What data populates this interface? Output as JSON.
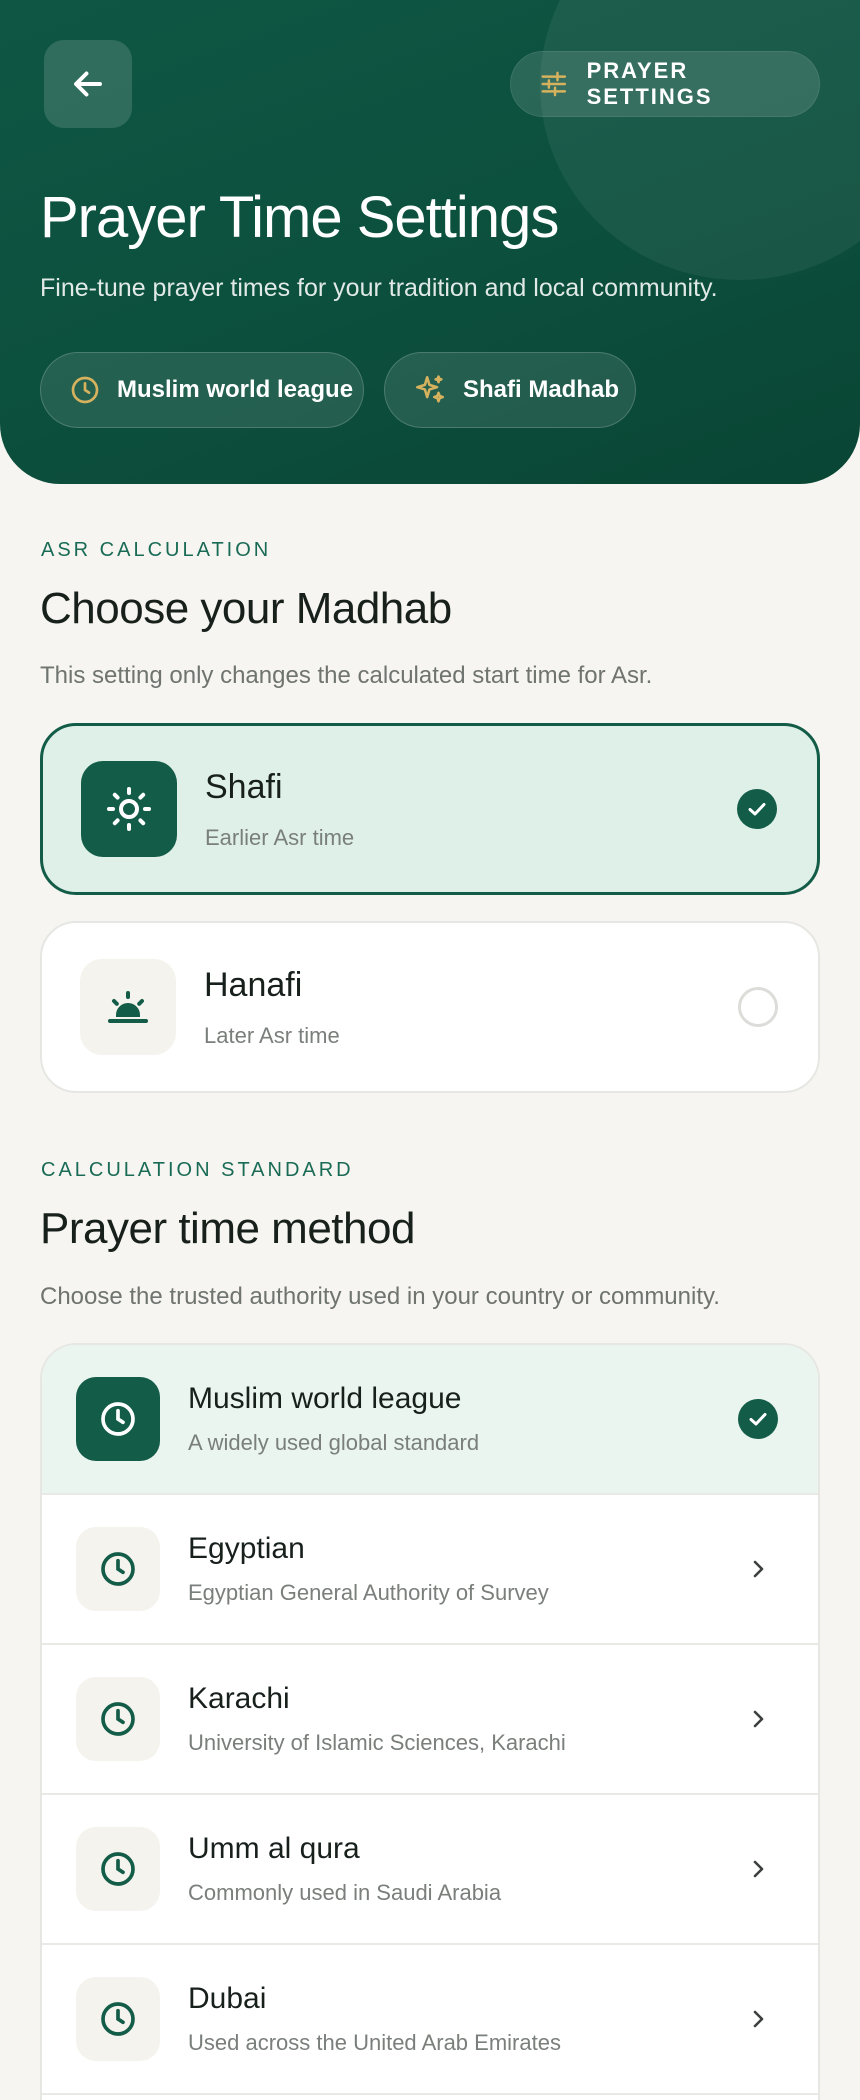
{
  "header": {
    "back_icon": "arrow-left-icon",
    "settings_label": "PRAYER SETTINGS",
    "settings_icon": "sliders-icon",
    "title": "Prayer Time Settings",
    "subtitle": "Fine-tune prayer times for your tradition and local community.",
    "chips": [
      {
        "label": "Muslim world league",
        "icon": "clock-icon"
      },
      {
        "label": "Shafi Madhab",
        "icon": "sparkles-icon"
      }
    ]
  },
  "madhab_section": {
    "eyebrow": "ASR CALCULATION",
    "title": "Choose your Madhab",
    "description": "This setting only changes the calculated start time for Asr.",
    "options": [
      {
        "name": "Shafi",
        "hint": "Earlier Asr time",
        "icon": "sun-icon",
        "selected": true
      },
      {
        "name": "Hanafi",
        "hint": "Later Asr time",
        "icon": "sunset-icon",
        "selected": false
      }
    ]
  },
  "method_section": {
    "eyebrow": "CALCULATION STANDARD",
    "title": "Prayer time method",
    "description": "Choose the trusted authority used in your country or community.",
    "methods": [
      {
        "name": "Muslim world league",
        "desc": "A widely used global standard",
        "selected": true
      },
      {
        "name": "Egyptian",
        "desc": "Egyptian General Authority of Survey",
        "selected": false
      },
      {
        "name": "Karachi",
        "desc": "University of Islamic Sciences, Karachi",
        "selected": false
      },
      {
        "name": "Umm al qura",
        "desc": "Commonly used in Saudi Arabia",
        "selected": false
      },
      {
        "name": "Dubai",
        "desc": "Used across the United Arab Emirates",
        "selected": false
      }
    ]
  },
  "colors": {
    "primary": "#135c48",
    "accent_gold": "#d6b25e",
    "background": "#f6f5f1"
  }
}
